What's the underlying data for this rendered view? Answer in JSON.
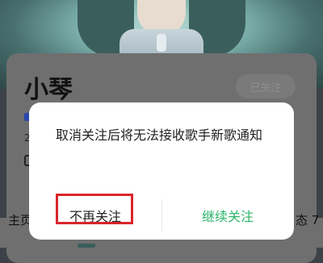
{
  "profile": {
    "name": "小琴",
    "follow_state": "已关注",
    "side_text": "2"
  },
  "tabs": {
    "home": "主页",
    "right": "态 7"
  },
  "dialog": {
    "message": "取消关注后将无法接收歌手新歌通知",
    "confirm_label": "不再关注",
    "cancel_label": "继续关注"
  },
  "colors": {
    "accent_green": "#2bb56a",
    "highlight_red": "#d9262c"
  }
}
